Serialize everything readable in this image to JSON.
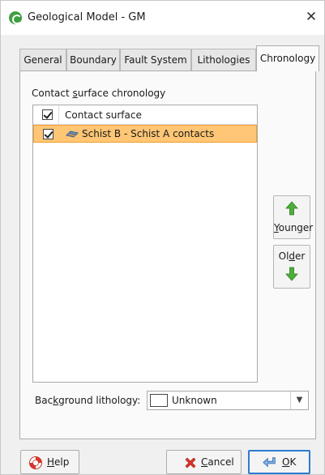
{
  "window": {
    "title": "Geological Model - GM",
    "close_glyph": "✕"
  },
  "tabs": [
    {
      "label": "General"
    },
    {
      "label": "Boundary"
    },
    {
      "label": "Fault System"
    },
    {
      "label": "Lithologies"
    },
    {
      "label": "Chronology",
      "active": true
    }
  ],
  "chronology": {
    "group_label_pre": "Contact ",
    "group_label_underlined": "s",
    "group_label_post": "urface chronology",
    "list_header": "Contact surface",
    "rows": [
      {
        "label": "Schist B - Schist A contacts",
        "checked": true,
        "selected": true
      }
    ],
    "younger_pre": "",
    "younger_underlined": "Y",
    "younger_post": "ounger",
    "older_pre": "Ol",
    "older_underlined": "d",
    "older_post": "er"
  },
  "background_lithology": {
    "label_pre": "Bac",
    "label_underlined": "k",
    "label_post": "ground lithology:",
    "value": "Unknown"
  },
  "buttons": {
    "help_underlined": "H",
    "help_post": "elp",
    "cancel_underlined": "C",
    "cancel_post": "ancel",
    "ok_underlined": "O",
    "ok_post": "K"
  },
  "colors": {
    "selected_row": "#ffc675",
    "arrow_green": "#4caf3a",
    "ok_border": "#2d7bd3"
  },
  "icons": {
    "app": "geological-model-icon",
    "row": "contact-surface-icon",
    "younger": "arrow-up-icon",
    "older": "arrow-down-icon",
    "help": "lifebuoy-icon",
    "cancel": "red-x-icon",
    "ok": "return-arrow-icon"
  }
}
